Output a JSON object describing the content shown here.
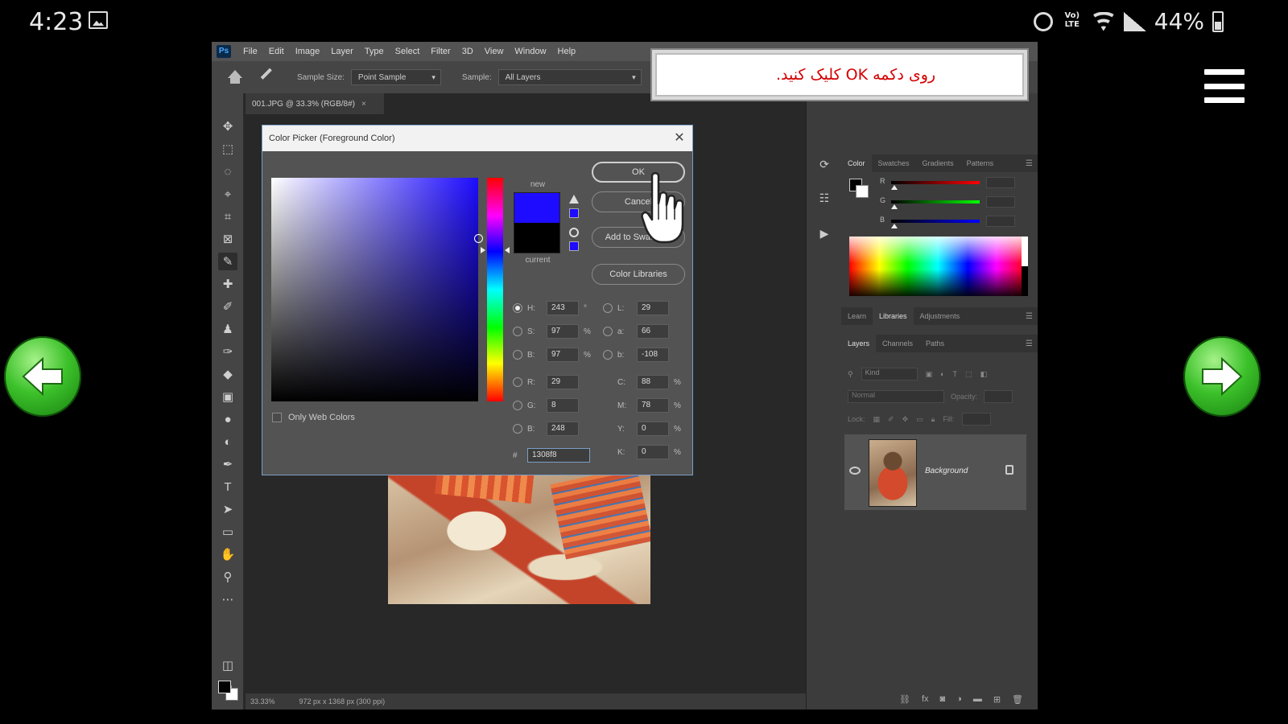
{
  "status_bar": {
    "time": "4:23",
    "lte_label": "Vo) LTE",
    "battery": "44%",
    "icons": [
      "gallery-icon",
      "alarm-icon",
      "lte-icon",
      "wifi-icon",
      "signal-icon",
      "battery-icon"
    ]
  },
  "navigation": {
    "menu_icon": "hamburger-icon",
    "prev_icon": "arrow-left-icon",
    "next_icon": "arrow-right-icon",
    "accent": "#3cc12a"
  },
  "instruction": {
    "text": "روی دکمه OK کلیک کنید.",
    "color": "#d40000"
  },
  "photoshop": {
    "menu": [
      "File",
      "Edit",
      "Image",
      "Layer",
      "Type",
      "Select",
      "Filter",
      "3D",
      "View",
      "Window",
      "Help"
    ],
    "options_bar": {
      "sample_size_label": "Sample Size:",
      "sample_size_value": "Point Sample",
      "sample_label": "Sample:",
      "sample_value": "All Layers"
    },
    "document_tab": "001.JPG @ 33.3% (RGB/8#)",
    "status": {
      "zoom": "33.33%",
      "doc_size": "972 px x 1368 px (300 ppi)"
    },
    "color_panel": {
      "tabs": [
        "Color",
        "Swatches",
        "Gradients",
        "Patterns"
      ],
      "active_tab": "Color",
      "channels": [
        "R",
        "G",
        "B"
      ]
    },
    "libraries_tabs": [
      "Learn",
      "Libraries",
      "Adjustments"
    ],
    "libraries_active": "Libraries",
    "layers_tabs": [
      "Layers",
      "Channels",
      "Paths"
    ],
    "layers_active": "Layers",
    "layers_controls": {
      "kind_label": "Kind",
      "blend_mode": "Normal",
      "opacity_label": "Opacity:",
      "lock_label": "Lock:",
      "fill_label": "Fill:"
    },
    "layer_name": "Background"
  },
  "color_picker": {
    "title": "Color Picker (Foreground Color)",
    "new_label": "new",
    "current_label": "current",
    "new_color": "#1d0cff",
    "current_color": "#000000",
    "hue_position": 0.323,
    "buttons": {
      "ok": "OK",
      "cancel": "Cancel",
      "add_to_swatches": "Add to Swatches",
      "color_libraries": "Color Libraries"
    },
    "hsb": [
      {
        "label": "H:",
        "value": "243",
        "unit": "°",
        "checked": true
      },
      {
        "label": "S:",
        "value": "97",
        "unit": "%",
        "checked": false
      },
      {
        "label": "B:",
        "value": "97",
        "unit": "%",
        "checked": false
      }
    ],
    "rgb": [
      {
        "label": "R:",
        "value": "29",
        "checked": false
      },
      {
        "label": "G:",
        "value": "8",
        "checked": false
      },
      {
        "label": "B:",
        "value": "248",
        "checked": false
      }
    ],
    "lab": [
      {
        "label": "L:",
        "value": "29",
        "checked": false
      },
      {
        "label": "a:",
        "value": "66",
        "checked": false
      },
      {
        "label": "b:",
        "value": "-108",
        "checked": false
      }
    ],
    "cmyk": [
      {
        "label": "C:",
        "value": "88",
        "unit": "%"
      },
      {
        "label": "M:",
        "value": "78",
        "unit": "%"
      },
      {
        "label": "Y:",
        "value": "0",
        "unit": "%"
      },
      {
        "label": "K:",
        "value": "0",
        "unit": "%"
      }
    ],
    "hex_label": "#",
    "hex_value": "1308f8",
    "only_web_colors": "Only Web Colors"
  }
}
